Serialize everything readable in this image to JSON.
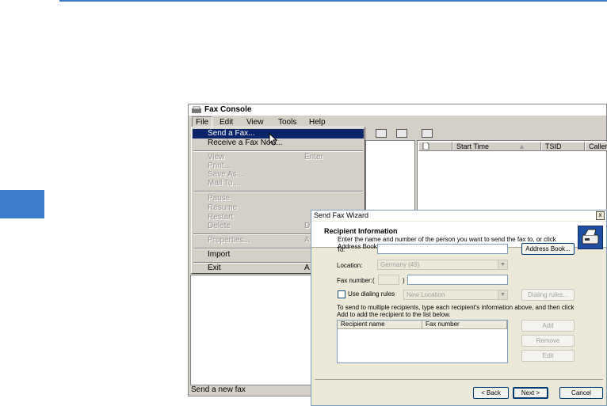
{
  "fax_console": {
    "title": "Fax Console",
    "menu": [
      "File",
      "Edit",
      "View",
      "Tools",
      "Help"
    ],
    "columns": [
      "Start Time",
      "TSID",
      "Caller"
    ],
    "status_text": "Send a new fax"
  },
  "file_menu": {
    "items": [
      {
        "label": "Send a Fax...",
        "shortcut": "",
        "state": "selected"
      },
      {
        "label": "Receive a Fax Now...",
        "shortcut": "",
        "state": "enabled"
      },
      {
        "label": "View",
        "shortcut": "Enter",
        "state": "disabled"
      },
      {
        "label": "Print...",
        "shortcut": "",
        "state": "disabled"
      },
      {
        "label": "Save As...",
        "shortcut": "",
        "state": "disabled"
      },
      {
        "label": "Mail To...",
        "shortcut": "",
        "state": "disabled"
      },
      {
        "label": "Pause",
        "shortcut": "",
        "state": "disabled"
      },
      {
        "label": "Resume",
        "shortcut": "",
        "state": "disabled"
      },
      {
        "label": "Restart",
        "shortcut": "",
        "state": "disabled"
      },
      {
        "label": "Delete",
        "shortcut": "D",
        "state": "disabled"
      },
      {
        "label": "Properties...",
        "shortcut": "A",
        "state": "disabled"
      },
      {
        "label": "Import",
        "shortcut": "",
        "state": "enabled"
      },
      {
        "label": "Exit",
        "shortcut": "A",
        "state": "enabled"
      }
    ]
  },
  "wizard": {
    "title": "Send Fax Wizard",
    "close": "x",
    "header_title": "Recipient Information",
    "header_desc": "Enter the name and number of the person you want to send the fax to, or click Address Book to select a fax recipient.",
    "to_label": "To:",
    "to_value": "",
    "location_label": "Location:",
    "location_value": "Germany (49)",
    "faxnumber_label": "Fax number:",
    "area_open": "(",
    "area_close": ")",
    "use_dialing_rules": "Use dialing rules",
    "dialing_location": "New Location",
    "address_book": "Address Book...",
    "dialing_rules_btn": "Dialing rules...",
    "multi_note": "To send to multiple recipients, type each recipient's information above, and then click Add to add the recipient to the list below.",
    "col_recipient": "Recipient name",
    "col_fax": "Fax number",
    "add": "Add",
    "remove": "Remove",
    "edit": "Edit",
    "back": "< Back",
    "next": "Next >",
    "cancel": "Cancel"
  },
  "colors": {
    "accent": "#3d7cc9",
    "menu_highlight": "#0a246a"
  }
}
